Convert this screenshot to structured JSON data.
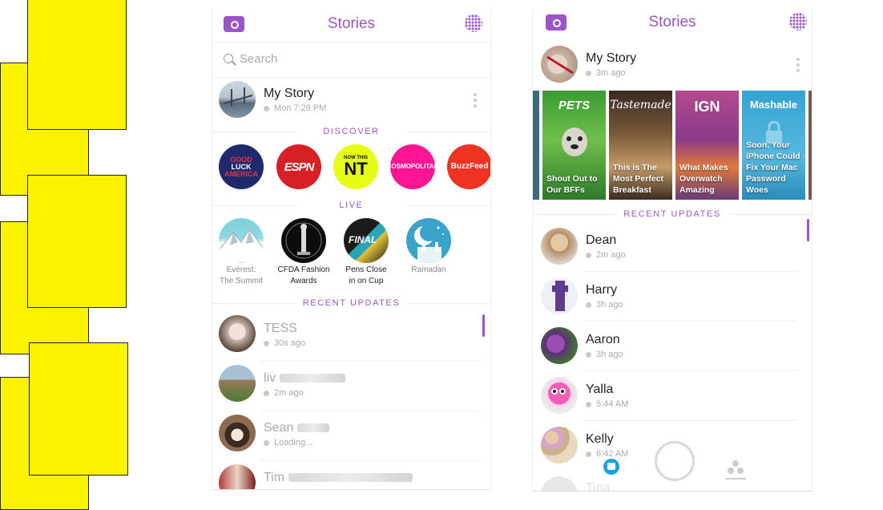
{
  "colors": {
    "accent": "#9b55c9",
    "yellow": "#fbf200"
  },
  "left_phone": {
    "title": "Stories",
    "search_placeholder": "Search",
    "my_story": {
      "name": "My Story",
      "time": "Mon 7:28 PM"
    },
    "discover_heading": "DISCOVER",
    "discover": [
      {
        "label": "GOOD LUCK AMERICA",
        "icon": "good-luck-america-logo"
      },
      {
        "label": "ESPN",
        "icon": "espn-logo"
      },
      {
        "label": "NOW THIS NT",
        "icon": "nowthis-logo"
      },
      {
        "label": "COSMOPOLITAN",
        "icon": "cosmopolitan-logo"
      },
      {
        "label": "BuzzFeed",
        "icon": "buzzfeed-logo"
      }
    ],
    "live_heading": "LIVE",
    "live": [
      {
        "line1": "Everest:",
        "line2": "The Summit"
      },
      {
        "line1": "CFDA Fashion",
        "line2": "Awards"
      },
      {
        "line1": "Pens Close",
        "line2": "in on Cup"
      },
      {
        "line1": "Ramadan",
        "line2": ""
      }
    ],
    "recent_heading": "RECENT UPDATES",
    "recent": [
      {
        "name": "TESS",
        "time": "30s ago"
      },
      {
        "name": "liv",
        "time": "2m ago"
      },
      {
        "name": "Sean",
        "time": "Loading..."
      },
      {
        "name": "Tim",
        "time": ""
      }
    ]
  },
  "right_phone": {
    "title": "Stories",
    "my_story": {
      "name": "My Story",
      "time": "3m ago"
    },
    "discover_tiles": [
      {
        "brand": "PETS",
        "caption": "Shout Out to Our BFFs"
      },
      {
        "brand": "Tastemade",
        "caption": "This is The Most Perfect Breakfast"
      },
      {
        "brand": "IGN",
        "caption": "What Makes Overwatch Amazing"
      },
      {
        "brand": "Mashable",
        "caption": "Soon, Your iPhone Could Fix Your Mac Password Woes"
      }
    ],
    "recent_heading": "RECENT UPDATES",
    "recent": [
      {
        "name": "Dean",
        "time": "2m ago"
      },
      {
        "name": "Harry",
        "time": "3h ago"
      },
      {
        "name": "Aaron",
        "time": "3h ago"
      },
      {
        "name": "Yalla",
        "time": "5:44 AM"
      },
      {
        "name": "Kelly",
        "time": "6:42 AM"
      },
      {
        "name": "Tina",
        "time": ""
      }
    ]
  }
}
